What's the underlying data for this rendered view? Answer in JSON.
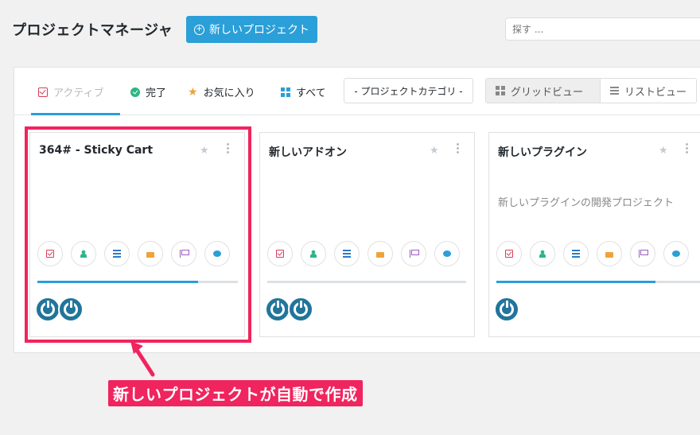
{
  "header": {
    "title": "プロジェクトマネージャ",
    "new_button": "新しいプロジェクト",
    "search_placeholder": "探す ..."
  },
  "tabs": [
    {
      "label": "アクティブ",
      "icon": "checkbox-icon",
      "active": true
    },
    {
      "label": "完了",
      "icon": "check-circle-icon"
    },
    {
      "label": "お気に入り",
      "icon": "star-icon"
    },
    {
      "label": "すべて",
      "icon": "grid-icon"
    }
  ],
  "category_select": "- プロジェクトカテゴリ -",
  "views": {
    "grid": "グリッドビュー",
    "list": "リストビュー"
  },
  "cards": [
    {
      "title": "364# - Sticky Cart",
      "description": "",
      "progress": 0.8,
      "avatars": 2
    },
    {
      "title": "新しいアドオン",
      "description": "",
      "progress": 0.0,
      "avatars": 2
    },
    {
      "title": "新しいプラグイン",
      "description": "新しいプラグインの開発プロジェクト",
      "progress": 0.8,
      "avatars": 1
    }
  ],
  "card_icons": [
    "task-icon",
    "user-icon",
    "list-icon",
    "folder-icon",
    "flag-icon",
    "chat-icon"
  ],
  "annotation": "新しいプロジェクトが自動で作成",
  "colors": {
    "accent": "#2a9fd8",
    "highlight": "#f0245e"
  }
}
